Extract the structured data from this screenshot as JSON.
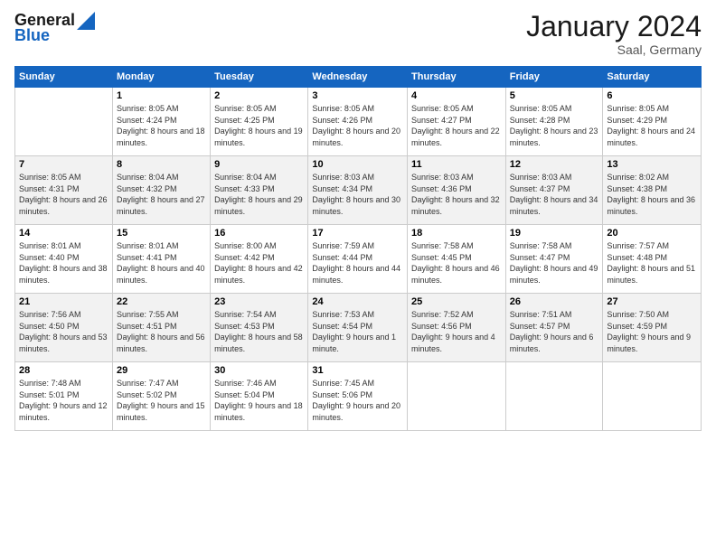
{
  "header": {
    "logo_line1": "General",
    "logo_line2": "Blue",
    "month_title": "January 2024",
    "location": "Saal, Germany"
  },
  "weekdays": [
    "Sunday",
    "Monday",
    "Tuesday",
    "Wednesday",
    "Thursday",
    "Friday",
    "Saturday"
  ],
  "weeks": [
    [
      {
        "day": "",
        "sunrise": "",
        "sunset": "",
        "daylight": ""
      },
      {
        "day": "1",
        "sunrise": "Sunrise: 8:05 AM",
        "sunset": "Sunset: 4:24 PM",
        "daylight": "Daylight: 8 hours and 18 minutes."
      },
      {
        "day": "2",
        "sunrise": "Sunrise: 8:05 AM",
        "sunset": "Sunset: 4:25 PM",
        "daylight": "Daylight: 8 hours and 19 minutes."
      },
      {
        "day": "3",
        "sunrise": "Sunrise: 8:05 AM",
        "sunset": "Sunset: 4:26 PM",
        "daylight": "Daylight: 8 hours and 20 minutes."
      },
      {
        "day": "4",
        "sunrise": "Sunrise: 8:05 AM",
        "sunset": "Sunset: 4:27 PM",
        "daylight": "Daylight: 8 hours and 22 minutes."
      },
      {
        "day": "5",
        "sunrise": "Sunrise: 8:05 AM",
        "sunset": "Sunset: 4:28 PM",
        "daylight": "Daylight: 8 hours and 23 minutes."
      },
      {
        "day": "6",
        "sunrise": "Sunrise: 8:05 AM",
        "sunset": "Sunset: 4:29 PM",
        "daylight": "Daylight: 8 hours and 24 minutes."
      }
    ],
    [
      {
        "day": "7",
        "sunrise": "Sunrise: 8:05 AM",
        "sunset": "Sunset: 4:31 PM",
        "daylight": "Daylight: 8 hours and 26 minutes."
      },
      {
        "day": "8",
        "sunrise": "Sunrise: 8:04 AM",
        "sunset": "Sunset: 4:32 PM",
        "daylight": "Daylight: 8 hours and 27 minutes."
      },
      {
        "day": "9",
        "sunrise": "Sunrise: 8:04 AM",
        "sunset": "Sunset: 4:33 PM",
        "daylight": "Daylight: 8 hours and 29 minutes."
      },
      {
        "day": "10",
        "sunrise": "Sunrise: 8:03 AM",
        "sunset": "Sunset: 4:34 PM",
        "daylight": "Daylight: 8 hours and 30 minutes."
      },
      {
        "day": "11",
        "sunrise": "Sunrise: 8:03 AM",
        "sunset": "Sunset: 4:36 PM",
        "daylight": "Daylight: 8 hours and 32 minutes."
      },
      {
        "day": "12",
        "sunrise": "Sunrise: 8:03 AM",
        "sunset": "Sunset: 4:37 PM",
        "daylight": "Daylight: 8 hours and 34 minutes."
      },
      {
        "day": "13",
        "sunrise": "Sunrise: 8:02 AM",
        "sunset": "Sunset: 4:38 PM",
        "daylight": "Daylight: 8 hours and 36 minutes."
      }
    ],
    [
      {
        "day": "14",
        "sunrise": "Sunrise: 8:01 AM",
        "sunset": "Sunset: 4:40 PM",
        "daylight": "Daylight: 8 hours and 38 minutes."
      },
      {
        "day": "15",
        "sunrise": "Sunrise: 8:01 AM",
        "sunset": "Sunset: 4:41 PM",
        "daylight": "Daylight: 8 hours and 40 minutes."
      },
      {
        "day": "16",
        "sunrise": "Sunrise: 8:00 AM",
        "sunset": "Sunset: 4:42 PM",
        "daylight": "Daylight: 8 hours and 42 minutes."
      },
      {
        "day": "17",
        "sunrise": "Sunrise: 7:59 AM",
        "sunset": "Sunset: 4:44 PM",
        "daylight": "Daylight: 8 hours and 44 minutes."
      },
      {
        "day": "18",
        "sunrise": "Sunrise: 7:58 AM",
        "sunset": "Sunset: 4:45 PM",
        "daylight": "Daylight: 8 hours and 46 minutes."
      },
      {
        "day": "19",
        "sunrise": "Sunrise: 7:58 AM",
        "sunset": "Sunset: 4:47 PM",
        "daylight": "Daylight: 8 hours and 49 minutes."
      },
      {
        "day": "20",
        "sunrise": "Sunrise: 7:57 AM",
        "sunset": "Sunset: 4:48 PM",
        "daylight": "Daylight: 8 hours and 51 minutes."
      }
    ],
    [
      {
        "day": "21",
        "sunrise": "Sunrise: 7:56 AM",
        "sunset": "Sunset: 4:50 PM",
        "daylight": "Daylight: 8 hours and 53 minutes."
      },
      {
        "day": "22",
        "sunrise": "Sunrise: 7:55 AM",
        "sunset": "Sunset: 4:51 PM",
        "daylight": "Daylight: 8 hours and 56 minutes."
      },
      {
        "day": "23",
        "sunrise": "Sunrise: 7:54 AM",
        "sunset": "Sunset: 4:53 PM",
        "daylight": "Daylight: 8 hours and 58 minutes."
      },
      {
        "day": "24",
        "sunrise": "Sunrise: 7:53 AM",
        "sunset": "Sunset: 4:54 PM",
        "daylight": "Daylight: 9 hours and 1 minute."
      },
      {
        "day": "25",
        "sunrise": "Sunrise: 7:52 AM",
        "sunset": "Sunset: 4:56 PM",
        "daylight": "Daylight: 9 hours and 4 minutes."
      },
      {
        "day": "26",
        "sunrise": "Sunrise: 7:51 AM",
        "sunset": "Sunset: 4:57 PM",
        "daylight": "Daylight: 9 hours and 6 minutes."
      },
      {
        "day": "27",
        "sunrise": "Sunrise: 7:50 AM",
        "sunset": "Sunset: 4:59 PM",
        "daylight": "Daylight: 9 hours and 9 minutes."
      }
    ],
    [
      {
        "day": "28",
        "sunrise": "Sunrise: 7:48 AM",
        "sunset": "Sunset: 5:01 PM",
        "daylight": "Daylight: 9 hours and 12 minutes."
      },
      {
        "day": "29",
        "sunrise": "Sunrise: 7:47 AM",
        "sunset": "Sunset: 5:02 PM",
        "daylight": "Daylight: 9 hours and 15 minutes."
      },
      {
        "day": "30",
        "sunrise": "Sunrise: 7:46 AM",
        "sunset": "Sunset: 5:04 PM",
        "daylight": "Daylight: 9 hours and 18 minutes."
      },
      {
        "day": "31",
        "sunrise": "Sunrise: 7:45 AM",
        "sunset": "Sunset: 5:06 PM",
        "daylight": "Daylight: 9 hours and 20 minutes."
      },
      {
        "day": "",
        "sunrise": "",
        "sunset": "",
        "daylight": ""
      },
      {
        "day": "",
        "sunrise": "",
        "sunset": "",
        "daylight": ""
      },
      {
        "day": "",
        "sunrise": "",
        "sunset": "",
        "daylight": ""
      }
    ]
  ]
}
